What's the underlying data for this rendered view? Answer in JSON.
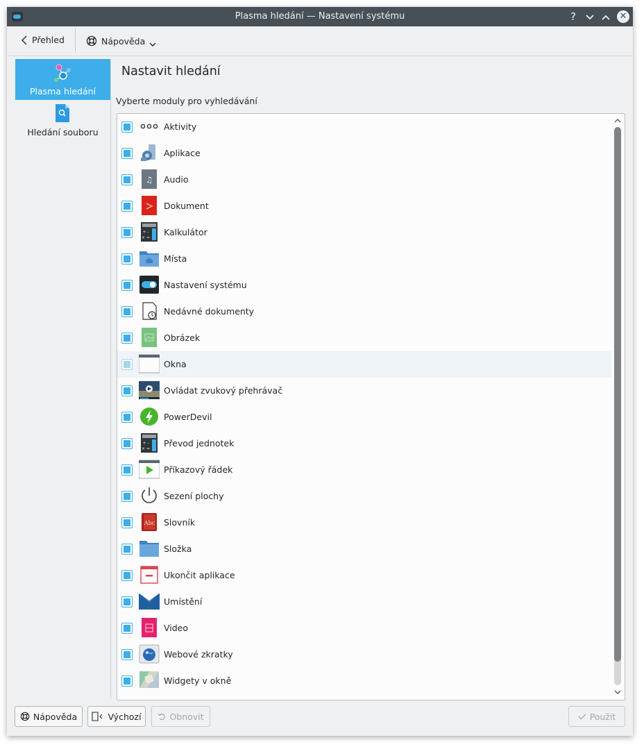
{
  "window": {
    "title": "Plasma hledání  — Nastavení systému"
  },
  "toolbar": {
    "back_label": "Přehled",
    "help_label": "Nápověda"
  },
  "sidebar": {
    "items": [
      {
        "label": "Plasma hledání",
        "selected": true
      },
      {
        "label": "Hledání souboru",
        "selected": false
      }
    ]
  },
  "main": {
    "title": "Nastavit hledání",
    "list_caption": "Vyberte moduly pro vyhledávání",
    "plugins": [
      {
        "label": "Aktivity",
        "icon": "activities-icon",
        "checked": true
      },
      {
        "label": "Aplikace",
        "icon": "applications-icon",
        "checked": true
      },
      {
        "label": "Audio",
        "icon": "audio-file-icon",
        "checked": true
      },
      {
        "label": "Dokument",
        "icon": "pdf-document-icon",
        "checked": true
      },
      {
        "label": "Kalkulátor",
        "icon": "calculator-icon",
        "checked": true
      },
      {
        "label": "Místa",
        "icon": "home-folder-icon",
        "checked": true
      },
      {
        "label": "Nastavení systému",
        "icon": "system-settings-icon",
        "checked": true
      },
      {
        "label": "Nedávné dokumenty",
        "icon": "recent-documents-icon",
        "checked": true
      },
      {
        "label": "Obrázek",
        "icon": "image-file-icon",
        "checked": true
      },
      {
        "label": "Okna",
        "icon": "window-icon",
        "checked": true
      },
      {
        "label": "Ovládat zvukový přehrávač",
        "icon": "media-player-icon",
        "checked": true
      },
      {
        "label": "PowerDevil",
        "icon": "power-icon",
        "checked": true
      },
      {
        "label": "Převod jednotek",
        "icon": "unit-converter-icon",
        "checked": true
      },
      {
        "label": "Příkazový řádek",
        "icon": "command-line-icon",
        "checked": true
      },
      {
        "label": "Sezení plochy",
        "icon": "session-power-icon",
        "checked": true
      },
      {
        "label": "Slovník",
        "icon": "dictionary-icon",
        "checked": true
      },
      {
        "label": "Složka",
        "icon": "folder-icon",
        "checked": true
      },
      {
        "label": "Ukončit aplikace",
        "icon": "kill-application-icon",
        "checked": true
      },
      {
        "label": "Umístění",
        "icon": "location-icon",
        "checked": true
      },
      {
        "label": "Video",
        "icon": "video-file-icon",
        "checked": true
      },
      {
        "label": "Webové zkratky",
        "icon": "web-shortcuts-icon",
        "checked": true
      },
      {
        "label": "Widgety v okně",
        "icon": "widgets-icon",
        "checked": true
      }
    ]
  },
  "buttons": {
    "help": "Nápověda",
    "defaults": "Výchozí",
    "reset": "Obnovit",
    "apply": "Použít"
  },
  "colors": {
    "accent": "#3daee9",
    "titlebar": "#475057",
    "window_bg": "#eff0f1"
  }
}
